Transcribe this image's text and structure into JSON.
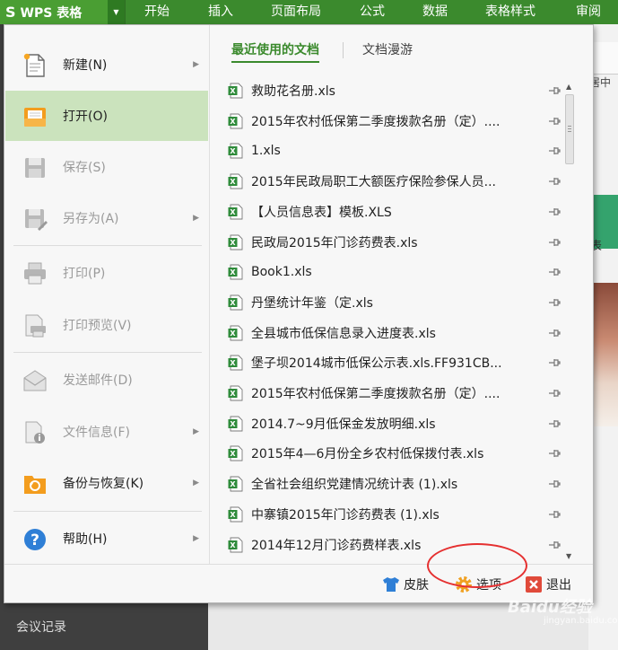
{
  "app": {
    "logo_glyph": "S",
    "name": "WPS 表格",
    "dropdown_glyph": "▼"
  },
  "ribbon_tabs": [
    "开始",
    "插入",
    "页面布局",
    "公式",
    "数据",
    "表格样式",
    "审阅"
  ],
  "menu_items": [
    {
      "label": "新建(N)",
      "icon": "new-file-icon",
      "enabled": true,
      "has_submenu": true,
      "active": false
    },
    {
      "label": "打开(O)",
      "icon": "open-folder-icon",
      "enabled": true,
      "has_submenu": false,
      "active": true
    },
    {
      "label": "保存(S)",
      "icon": "save-icon",
      "enabled": false,
      "has_submenu": false,
      "active": false
    },
    {
      "label": "另存为(A)",
      "icon": "save-as-icon",
      "enabled": false,
      "has_submenu": true,
      "active": false
    },
    {
      "label": "打印(P)",
      "icon": "print-icon",
      "enabled": false,
      "has_submenu": false,
      "active": false
    },
    {
      "label": "打印预览(V)",
      "icon": "print-preview-icon",
      "enabled": false,
      "has_submenu": false,
      "active": false
    },
    {
      "label": "发送邮件(D)",
      "icon": "mail-icon",
      "enabled": false,
      "has_submenu": false,
      "active": false
    },
    {
      "label": "文件信息(F)",
      "icon": "file-info-icon",
      "enabled": false,
      "has_submenu": true,
      "active": false
    },
    {
      "label": "备份与恢复(K)",
      "icon": "backup-restore-icon",
      "enabled": true,
      "has_submenu": true,
      "active": false
    },
    {
      "label": "帮助(H)",
      "icon": "help-icon",
      "enabled": true,
      "has_submenu": true,
      "active": false
    }
  ],
  "panel_tabs": {
    "recent": "最近使用的文档",
    "roam": "文档漫游"
  },
  "recent_files": [
    "救助花名册.xls",
    "2015年农村低保第二季度拨款名册（定）....",
    "1.xls",
    "2015年民政局职工大额医疗保险参保人员...",
    "【人员信息表】模板.XLS",
    "民政局2015年门诊药费表.xls",
    "Book1.xls",
    "丹堡统计年鉴（定.xls",
    "全县城市低保信息录入进度表.xls",
    "堡子坝2014城市低保公示表.xls.FF931CB...",
    "2015年农村低保第二季度拨款名册（定）....",
    "2014.7~9月低保金发放明细.xls",
    "2015年4—6月份全乡农村低保拨付表.xls",
    "全省社会组织党建情况统计表 (1).xls",
    "中寨镇2015年门诊药费表 (1).xls",
    "2014年12月门诊药费样表.xls"
  ],
  "bottom_buttons": {
    "skin": "皮肤",
    "options": "选项",
    "exit": "退出"
  },
  "background": {
    "sidebar_label": "会议记录",
    "right_text_top": "居中",
    "right_text_mid": "表"
  },
  "watermark": {
    "main": "Baidu经验",
    "sub": "jingyan.baidu.com"
  },
  "colors": {
    "accent_green": "#3b8a2d",
    "active_bg": "#cbe3bd",
    "highlight_red": "#e53030",
    "excel_green": "#2e8b3a"
  }
}
